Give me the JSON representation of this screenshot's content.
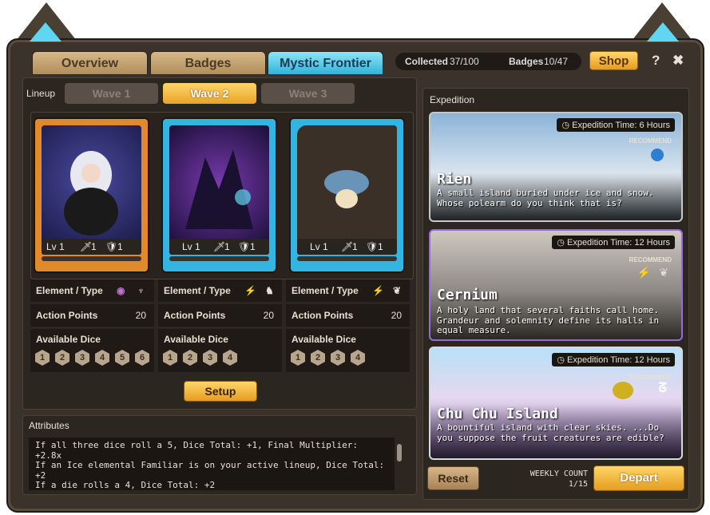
{
  "tabs": [
    {
      "label": "Overview"
    },
    {
      "label": "Badges"
    },
    {
      "label": "Mystic Frontier"
    }
  ],
  "stats": {
    "collected_label": "Collected",
    "collected_value": "37/100",
    "badges_label": "Badges",
    "badges_value": "10/47"
  },
  "header": {
    "shop_label": "Shop",
    "help_icon": "?",
    "close_icon": "✖"
  },
  "lineup": {
    "label": "Lineup",
    "waves": [
      "Wave 1",
      "Wave 2",
      "Wave 3"
    ],
    "active_wave": "Wave 2"
  },
  "cards": [
    {
      "lv": "Lv 1",
      "atk": "1",
      "def": "1",
      "element_label": "Element / Type",
      "ap_label": "Action Points",
      "ap": "20",
      "dice_label": "Available Dice",
      "dice": [
        "1",
        "2",
        "3",
        "4",
        "5",
        "6"
      ],
      "color": "#e08a2c"
    },
    {
      "lv": "Lv 1",
      "atk": "1",
      "def": "1",
      "element_label": "Element / Type",
      "ap_label": "Action Points",
      "ap": "20",
      "dice_label": "Available Dice",
      "dice": [
        "1",
        "2",
        "3",
        "4"
      ],
      "color": "#34b4e0"
    },
    {
      "lv": "Lv 1",
      "atk": "1",
      "def": "1",
      "element_label": "Element / Type",
      "ap_label": "Action Points",
      "ap": "20",
      "dice_label": "Available Dice",
      "dice": [
        "1",
        "2",
        "3",
        "4"
      ],
      "color": "#34b4e0"
    }
  ],
  "setup_label": "Setup",
  "attributes": {
    "label": "Attributes",
    "lines": [
      "If all three dice roll a 5, Dice Total: +1, Final Multiplier: +2.8x",
      "If an Ice elemental Familiar is on your active lineup, Dice Total: +2",
      "If a die rolls a 4, Dice Total: +2"
    ]
  },
  "expedition": {
    "label": "Expedition",
    "items": [
      {
        "time": "Expedition Time: 6 Hours",
        "recommend": "RECOMMEND",
        "name": "Rien",
        "desc": "A small island buried under ice and snow. Whose polearm do you think that is?"
      },
      {
        "time": "Expedition Time: 12 Hours",
        "recommend": "RECOMMEND",
        "name": "Cernium",
        "desc": "A holy land that several faiths call home. Grandeur and solemnity define its halls in equal measure."
      },
      {
        "time": "Expedition Time: 12 Hours",
        "recommend": "RECOMMEND",
        "name": "Chu Chu Island",
        "desc": "A bountiful island with clear skies. ...Do you suppose the fruit creatures are edible?"
      }
    ]
  },
  "footer": {
    "reset_label": "Reset",
    "weekly_label": "WEEKLY COUNT",
    "weekly_value": "1/15",
    "depart_label": "Depart"
  }
}
